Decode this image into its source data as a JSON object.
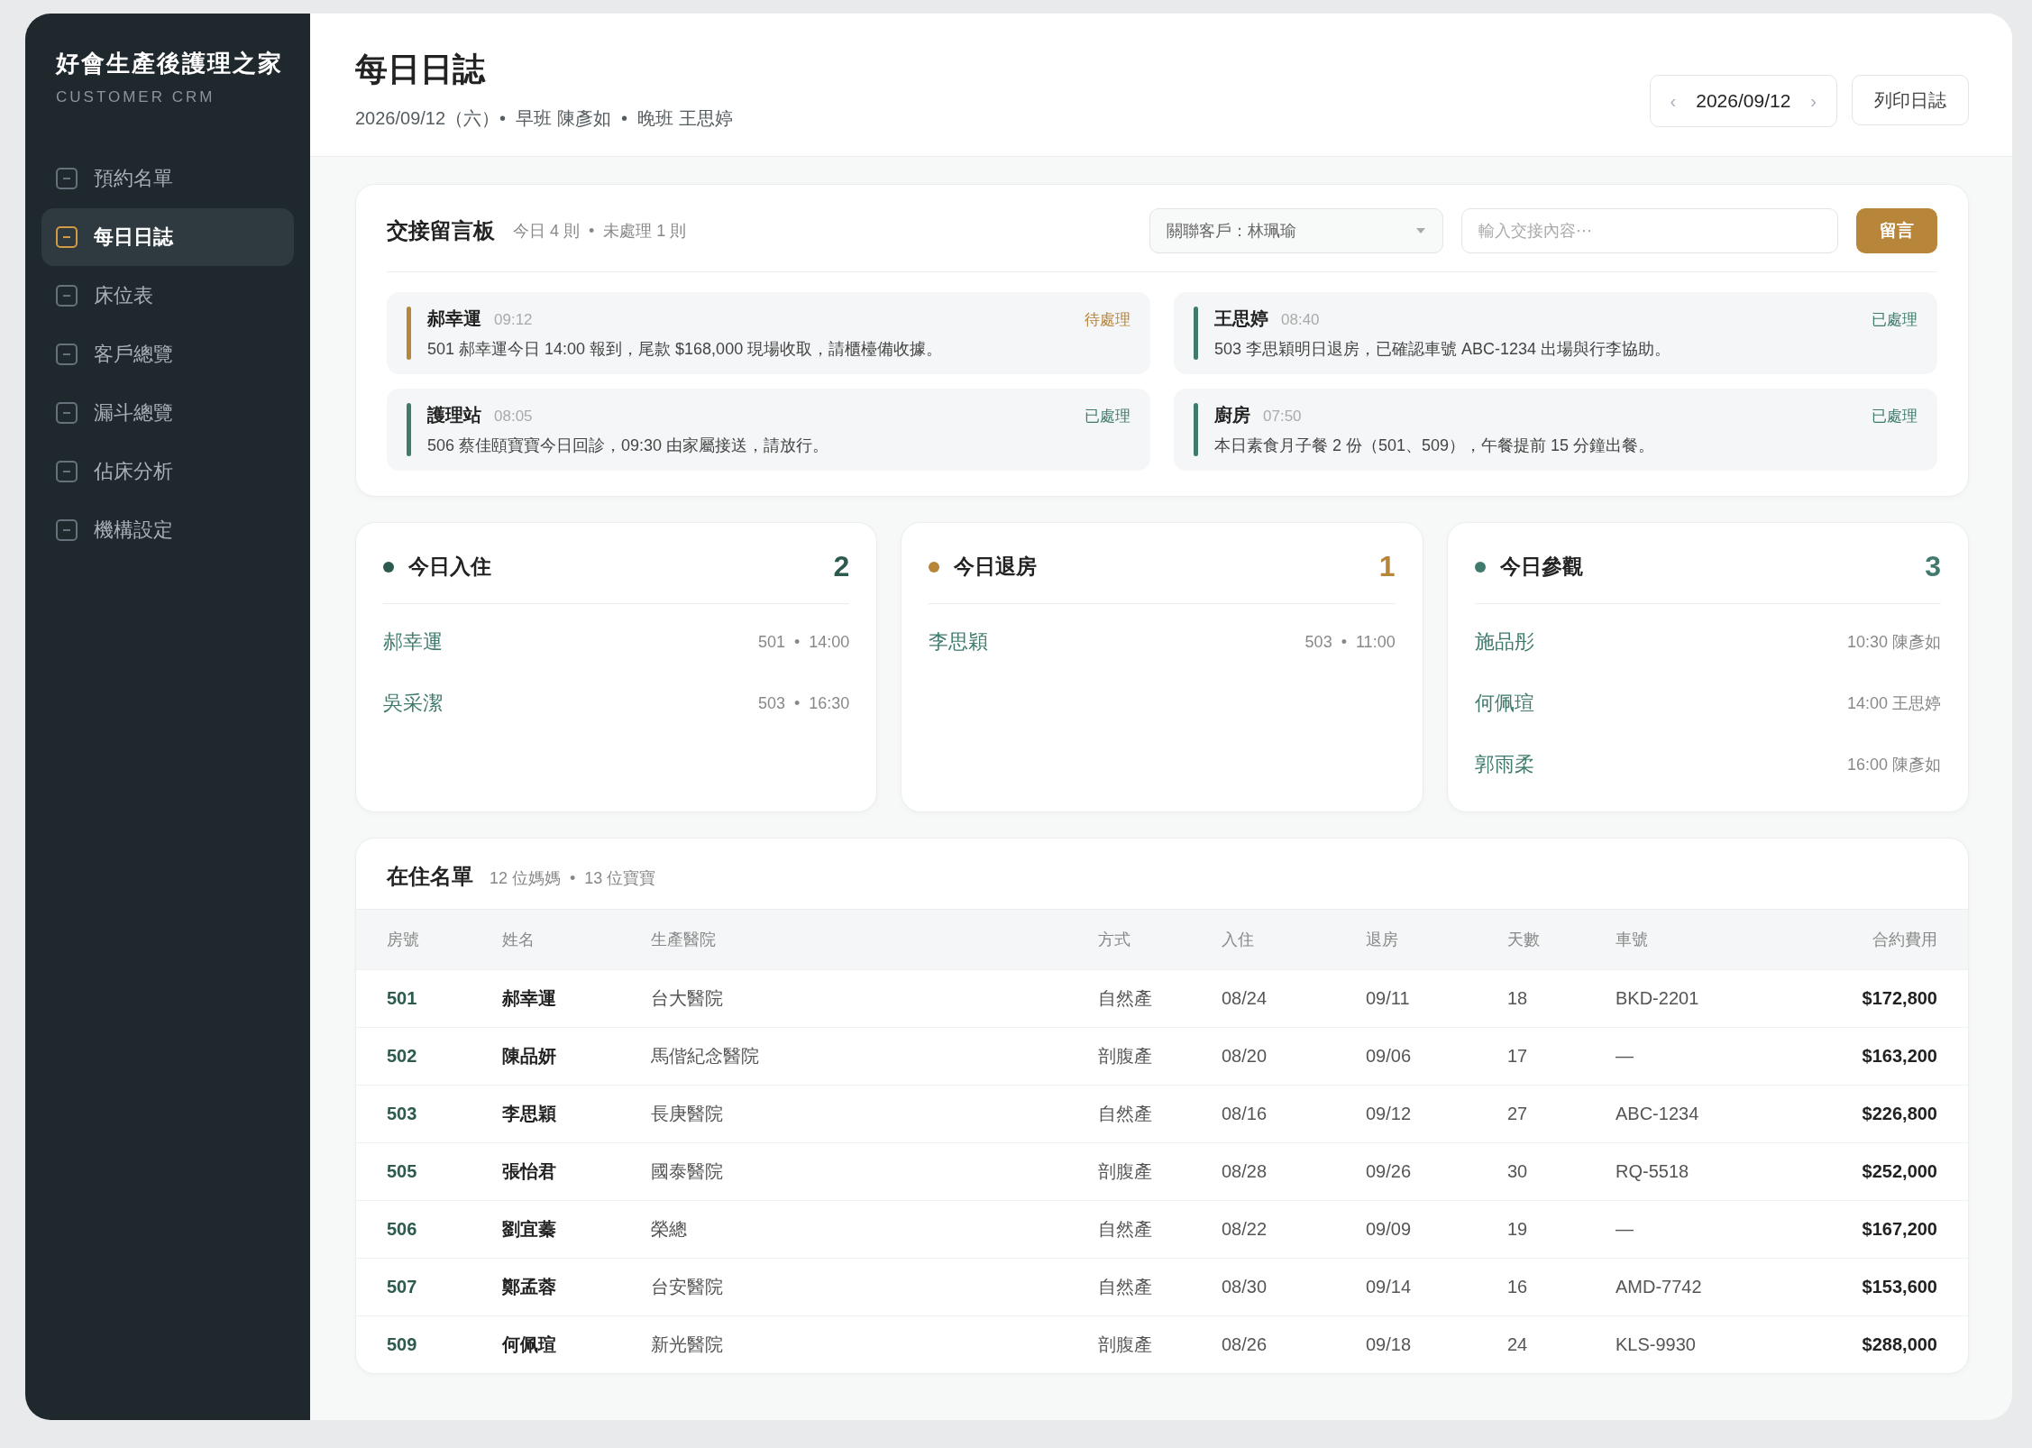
{
  "sidebar": {
    "brand": "好會生產後護理之家",
    "subtitle": "CUSTOMER CRM",
    "items": [
      {
        "label": "預約名單",
        "selected": false
      },
      {
        "label": "每日日誌",
        "selected": true
      },
      {
        "label": "床位表",
        "selected": false
      },
      {
        "label": "客戶總覽",
        "selected": false
      },
      {
        "label": "漏斗總覽",
        "selected": false
      },
      {
        "label": "佔床分析",
        "selected": false
      },
      {
        "label": "機構設定",
        "selected": false
      }
    ]
  },
  "header": {
    "title": "每日日誌",
    "subtitle": "2026/09/12（六）•  早班 陳彥如  •  晚班 王思婷",
    "date_picker": {
      "prev": "‹",
      "value": "2026/09/12",
      "next": "›"
    },
    "print_button": "列印日誌"
  },
  "handover": {
    "title": "交接留言板",
    "summary": "今日 4 則  •  未處理 1 則",
    "client_select": {
      "value": "關聯客戶：林珮瑜"
    },
    "message_input": {
      "placeholder": "輸入交接內容⋯"
    },
    "submit_button": "留言",
    "messages": [
      {
        "author": "郝幸運",
        "time": "09:12",
        "status": "待處理",
        "resolved": false,
        "text": "501 郝幸運今日 14:00 報到，尾款 $168,000 現場收取，請櫃檯備收據。"
      },
      {
        "author": "王思婷",
        "time": "08:40",
        "status": "已處理",
        "resolved": true,
        "text": "503 李思穎明日退房，已確認車號 ABC-1234 出場與行李協助。"
      },
      {
        "author": "護理站",
        "time": "08:05",
        "status": "已處理",
        "resolved": true,
        "text": "506 蔡佳頤寶寶今日回診，09:30 由家屬接送，請放行。"
      },
      {
        "author": "廚房",
        "time": "07:50",
        "status": "已處理",
        "resolved": true,
        "text": "本日素食月子餐 2 份（501、509），午餐提前 15 分鐘出餐。"
      }
    ]
  },
  "today_cards": [
    {
      "title": "今日入住",
      "count": "2",
      "color": "#2d5a4e",
      "rows": [
        {
          "name": "郝幸運",
          "detail": "501  •  14:00"
        },
        {
          "name": "吳采潔",
          "detail": "503  •  16:30"
        }
      ]
    },
    {
      "title": "今日退房",
      "count": "1",
      "color": "#b8863b",
      "rows": [
        {
          "name": "李思穎",
          "detail": "503  •  11:00"
        }
      ]
    },
    {
      "title": "今日參觀",
      "count": "3",
      "color": "#3f7a6c",
      "rows": [
        {
          "name": "施品彤",
          "detail": "10:30 陳彥如"
        },
        {
          "name": "何佩瑄",
          "detail": "14:00 王思婷"
        },
        {
          "name": "郭雨柔",
          "detail": "16:00 陳彥如"
        }
      ]
    }
  ],
  "residents": {
    "title": "在住名單",
    "summary": "12 位媽媽  •  13 位寶寶",
    "columns": [
      "房號",
      "姓名",
      "生產醫院",
      "方式",
      "入住",
      "退房",
      "天數",
      "車號",
      "合約費用"
    ],
    "rows": [
      [
        "501",
        "郝幸運",
        "台大醫院",
        "自然產",
        "08/24",
        "09/11",
        "18",
        "BKD-2201",
        "$172,800"
      ],
      [
        "502",
        "陳品妍",
        "馬偕紀念醫院",
        "剖腹產",
        "08/20",
        "09/06",
        "17",
        "—",
        "$163,200"
      ],
      [
        "503",
        "李思穎",
        "長庚醫院",
        "自然產",
        "08/16",
        "09/12",
        "27",
        "ABC-1234",
        "$226,800"
      ],
      [
        "505",
        "張怡君",
        "國泰醫院",
        "剖腹產",
        "08/28",
        "09/26",
        "30",
        "RQ-5518",
        "$252,000"
      ],
      [
        "506",
        "劉宜蓁",
        "榮總",
        "自然產",
        "08/22",
        "09/09",
        "19",
        "—",
        "$167,200"
      ],
      [
        "507",
        "鄭孟蓉",
        "台安醫院",
        "自然產",
        "08/30",
        "09/14",
        "16",
        "AMD-7742",
        "$153,600"
      ],
      [
        "509",
        "何佩瑄",
        "新光醫院",
        "剖腹產",
        "08/26",
        "09/18",
        "24",
        "KLS-9930",
        "$288,000"
      ]
    ]
  }
}
